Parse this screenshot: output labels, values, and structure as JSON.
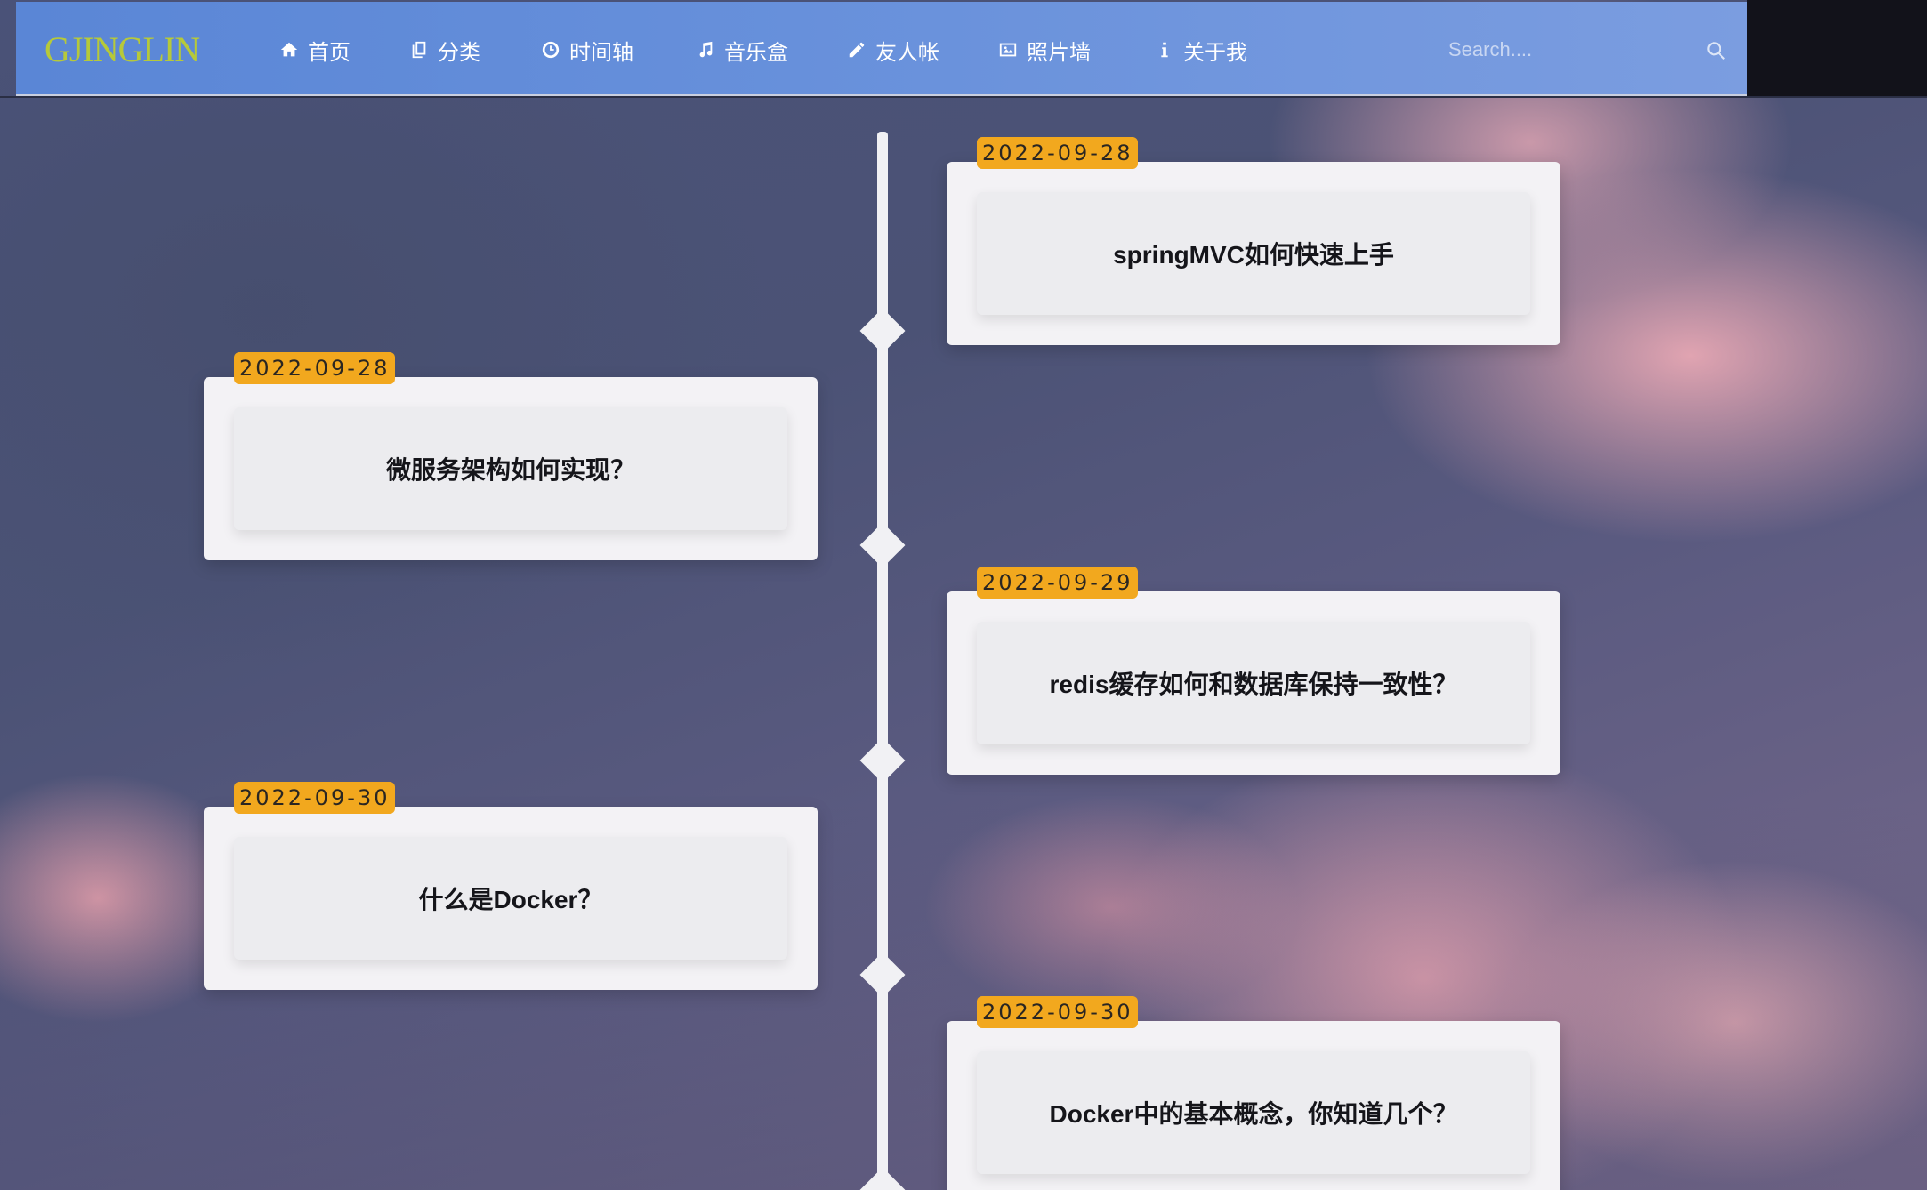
{
  "navbar": {
    "logo": "GJINGLIN",
    "items": [
      {
        "label": "首页",
        "icon": "home-icon"
      },
      {
        "label": "分类",
        "icon": "copy-icon"
      },
      {
        "label": "时间轴",
        "icon": "clock-icon"
      },
      {
        "label": "音乐盒",
        "icon": "music-icon"
      },
      {
        "label": "友人帐",
        "icon": "pencil-icon"
      },
      {
        "label": "照片墙",
        "icon": "picture-icon"
      },
      {
        "label": "关于我",
        "icon": "info-icon"
      }
    ],
    "search": {
      "placeholder": "Search...."
    }
  },
  "timeline": {
    "entries": [
      {
        "date": "2022-09-28",
        "title": "springMVC如何快速上手",
        "side": "right"
      },
      {
        "date": "2022-09-28",
        "title": "微服务架构如何实现？",
        "side": "left"
      },
      {
        "date": "2022-09-29",
        "title": "redis缓存如何和数据库保持一致性？",
        "side": "right"
      },
      {
        "date": "2022-09-30",
        "title": "什么是Docker？",
        "side": "left"
      },
      {
        "date": "2022-09-30",
        "title": "Docker中的基本概念，你知道几个？",
        "side": "right"
      }
    ]
  }
}
